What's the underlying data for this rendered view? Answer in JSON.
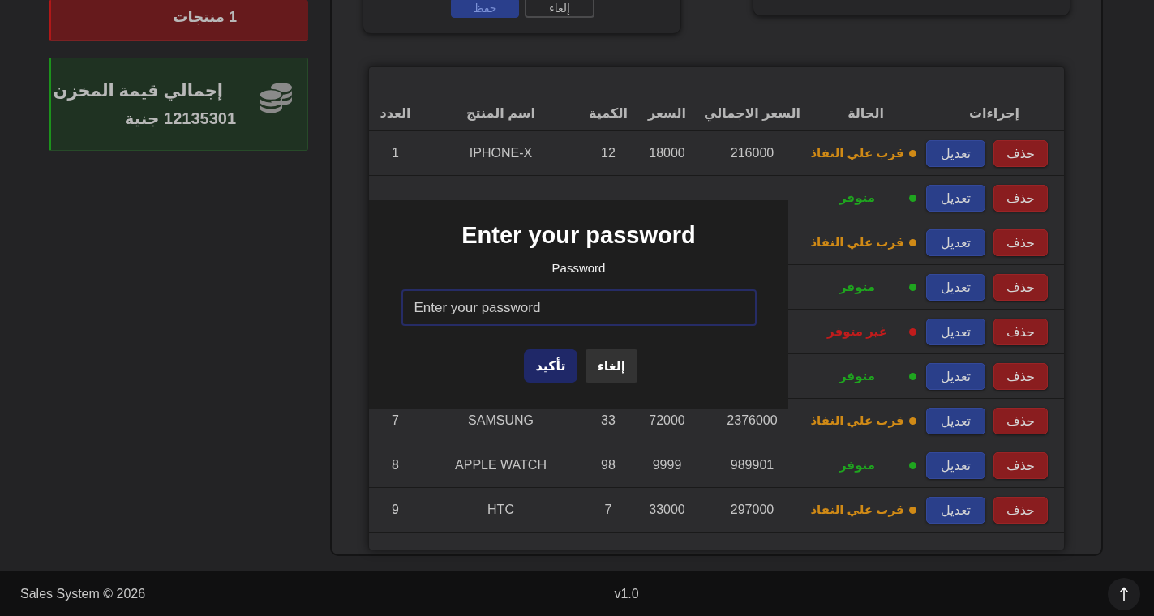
{
  "sidebar": {
    "cards": [
      {
        "kind": "products",
        "value": "1 منتجات"
      },
      {
        "kind": "inventory",
        "title": "إجمالي قيمة المخزن",
        "value": "12135301 جنية"
      }
    ]
  },
  "form": {
    "buttons": [
      {
        "label": "إلغاء",
        "kind": "secondary"
      },
      {
        "label": "حفظ",
        "kind": "primary"
      }
    ]
  },
  "table": {
    "columns": [
      "إجراءات",
      "الحالة",
      "السعر الاجمالي",
      "السعر",
      "الكمية",
      "اسم المنتج",
      "العدد"
    ],
    "rows": [
      {
        "actions": [
          {
            "label": "حذف",
            "kind": "delete"
          },
          {
            "label": "تعديل",
            "kind": "edit"
          }
        ],
        "status": {
          "label": "قرب علي النفاذ",
          "color": "#d08a16"
        },
        "total": "216000",
        "price": "18000",
        "quantity": "12",
        "name": "IPHONE-X",
        "number": "1"
      },
      {
        "actions": [
          {
            "label": "حذف",
            "kind": "delete"
          },
          {
            "label": "تعديل",
            "kind": "edit"
          }
        ],
        "status": {
          "label": "متوفر",
          "color": "#1fa51f"
        }
      },
      {
        "actions": [
          {
            "label": "حذف",
            "kind": "delete"
          },
          {
            "label": "تعديل",
            "kind": "edit"
          }
        ],
        "status": {
          "label": "قرب علي النفاذ",
          "color": "#d08a16"
        }
      },
      {
        "actions": [
          {
            "label": "حذف",
            "kind": "delete"
          },
          {
            "label": "تعديل",
            "kind": "edit"
          }
        ],
        "status": {
          "label": "متوفر",
          "color": "#1fa51f"
        }
      },
      {
        "actions": [
          {
            "label": "حذف",
            "kind": "delete"
          },
          {
            "label": "تعديل",
            "kind": "edit"
          }
        ],
        "status": {
          "label": "غير متوفر",
          "color": "#c01c1c"
        }
      },
      {
        "actions": [
          {
            "label": "حذف",
            "kind": "delete"
          },
          {
            "label": "تعديل",
            "kind": "edit"
          }
        ],
        "status": {
          "label": "متوفر",
          "color": "#1fa51f"
        }
      },
      {
        "actions": [
          {
            "label": "حذف",
            "kind": "delete"
          },
          {
            "label": "تعديل",
            "kind": "edit"
          }
        ],
        "status": {
          "label": "قرب علي النفاذ",
          "color": "#d08a16"
        },
        "total": "2376000",
        "price": "72000",
        "quantity": "33",
        "name": "SAMSUNG",
        "number": "7"
      },
      {
        "actions": [
          {
            "label": "حذف",
            "kind": "delete"
          },
          {
            "label": "تعديل",
            "kind": "edit"
          }
        ],
        "status": {
          "label": "متوفر",
          "color": "#1fa51f"
        },
        "total": "989901",
        "price": "9999",
        "quantity": "98",
        "name": "APPLE WATCH",
        "number": "8"
      },
      {
        "actions": [
          {
            "label": "حذف",
            "kind": "delete"
          },
          {
            "label": "تعديل",
            "kind": "edit"
          }
        ],
        "status": {
          "label": "قرب علي النفاذ",
          "color": "#d08a16"
        },
        "total": "297000",
        "price": "33000",
        "quantity": "7",
        "name": "HTC",
        "number": "9"
      }
    ]
  },
  "dialog": {
    "title": "Enter your password",
    "label": "Password",
    "field": {
      "placeholder": "Enter your password"
    },
    "buttons": [
      {
        "label": "إلغاء",
        "kind": "secondary"
      },
      {
        "label": "تأكيد",
        "kind": "primary"
      }
    ]
  },
  "footer": {
    "copyright": "Sales System © 2026",
    "version": "v1.0"
  }
}
